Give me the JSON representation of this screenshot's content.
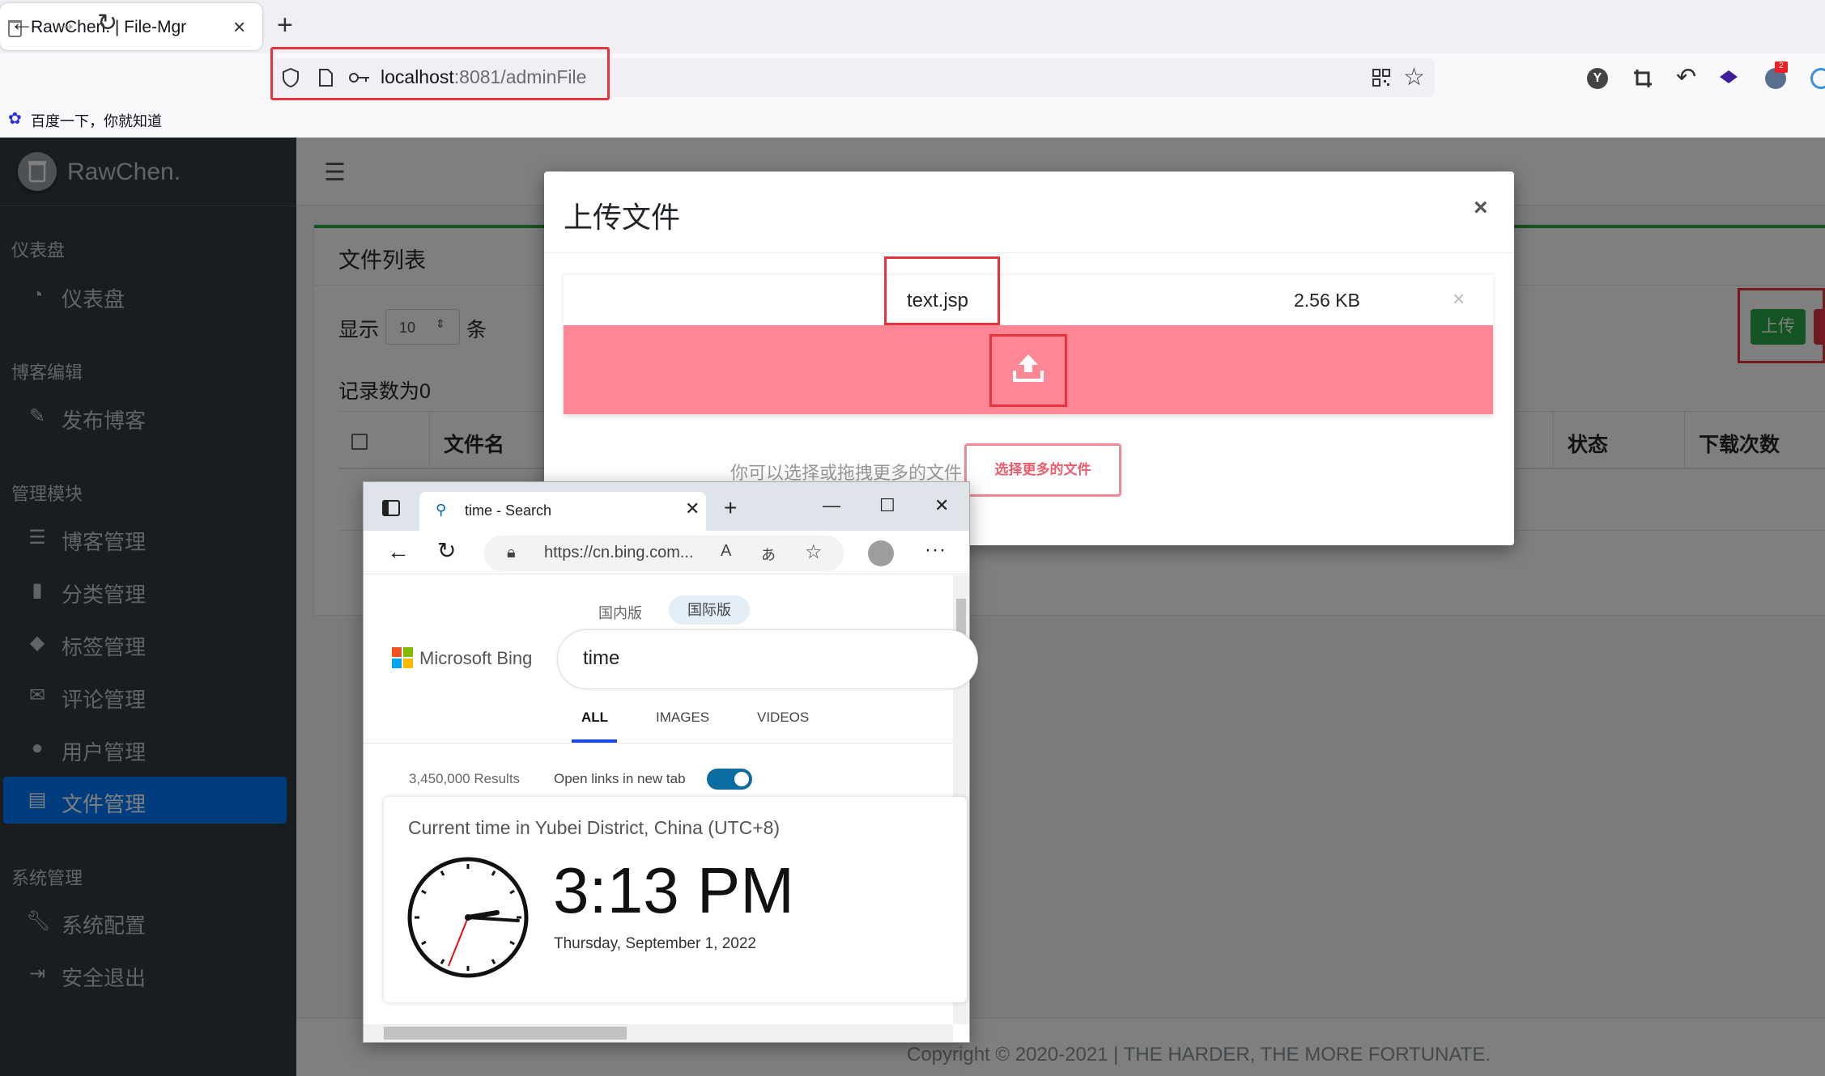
{
  "browser": {
    "tab_title": "RawChen. | File-Mgr",
    "url_host": "localhost",
    "url_rest": ":8081/adminFile",
    "bookmark": "百度一下，你就知道"
  },
  "sidebar": {
    "brand": "RawChen.",
    "sections": [
      {
        "title": "仪表盘",
        "items": [
          {
            "label": "仪表盘",
            "icon": "tachometer-icon"
          }
        ]
      },
      {
        "title": "博客编辑",
        "items": [
          {
            "label": "发布博客",
            "icon": "edit-icon"
          }
        ]
      },
      {
        "title": "管理模块",
        "items": [
          {
            "label": "博客管理",
            "icon": "list-icon"
          },
          {
            "label": "分类管理",
            "icon": "bookmark-icon"
          },
          {
            "label": "标签管理",
            "icon": "tags-icon"
          },
          {
            "label": "评论管理",
            "icon": "comments-icon"
          },
          {
            "label": "用户管理",
            "icon": "user-icon"
          },
          {
            "label": "文件管理",
            "icon": "file-code-icon",
            "active": true
          }
        ]
      },
      {
        "title": "系统管理",
        "items": [
          {
            "label": "系统配置",
            "icon": "wrench-icon"
          },
          {
            "label": "安全退出",
            "icon": "sign-out-icon"
          }
        ]
      }
    ]
  },
  "main": {
    "card_title": "文件列表",
    "show_label": "显示",
    "page_length": "10",
    "items_label": "条",
    "record_count": "记录数为0",
    "upload_button": "上传",
    "columns": [
      "文件名",
      "状态",
      "下载次数"
    ],
    "footer": "Copyright © 2020-2021 | THE HARDER, THE MORE FORTUNATE."
  },
  "modal": {
    "title": "上传文件",
    "close": "×",
    "file": {
      "name": "text.jsp",
      "size": "2.56 KB",
      "remove": "×"
    },
    "drop_color": "#ff8795",
    "more_hint": "你可以选择或拖拽更多的文件",
    "more_button": "选择更多的文件"
  },
  "edge": {
    "tab_title": "time - Search",
    "url": "https://cn.bing.com...",
    "bing": {
      "region_cn": "国内版",
      "region_intl": "国际版",
      "brand": "Microsoft Bing",
      "query": "time",
      "tabs": [
        "ALL",
        "IMAGES",
        "VIDEOS"
      ],
      "results": "3,450,000 Results",
      "open_new_tab": "Open links in new tab",
      "card_title": "Current time in Yubei District, China (UTC+8)",
      "time": "3:13 PM",
      "date": "Thursday, September 1, 2022"
    }
  }
}
